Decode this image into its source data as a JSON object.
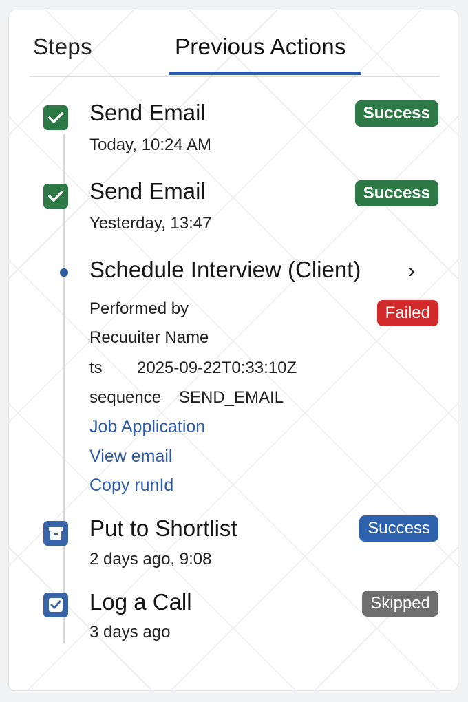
{
  "tabs": {
    "steps": "Steps",
    "previous_actions": "Previous Actions"
  },
  "colors": {
    "success_green": "#2e7a47",
    "success_blue": "#2e62ad",
    "failed_red": "#d22a2a",
    "skipped_gray": "#6e6e6e",
    "link_blue": "#2c5aa6",
    "accent_blue": "#2b5aa6"
  },
  "actions": [
    {
      "title": "Send Email",
      "time": "Today, 10:24 AM",
      "status": "Success",
      "icon": "check-icon"
    },
    {
      "title": "Send Email",
      "time": "Yesterday, 13:47",
      "status": "Success",
      "icon": "check-icon"
    },
    {
      "title": "Schedule Interview (Client)",
      "status": "Failed",
      "performed_by_label": "Performed by",
      "performed_by_name": "Recuuiter Name",
      "ts_label": "ts",
      "ts_value": "2025-09-22T0:33:10Z",
      "sequence_label": "sequence",
      "sequence_value": "SEND_EMAIL",
      "links": [
        "Job Application",
        "View email",
        "Copy runId"
      ],
      "icon": "chevron-right-icon"
    },
    {
      "title": "Put to Shortlist",
      "time": "2 days ago, 9:08",
      "status": "Success",
      "icon": "archive-box-icon"
    },
    {
      "title": "Log a Call",
      "time": "3 days ago",
      "status": "Skipped",
      "icon": "check-icon"
    }
  ]
}
